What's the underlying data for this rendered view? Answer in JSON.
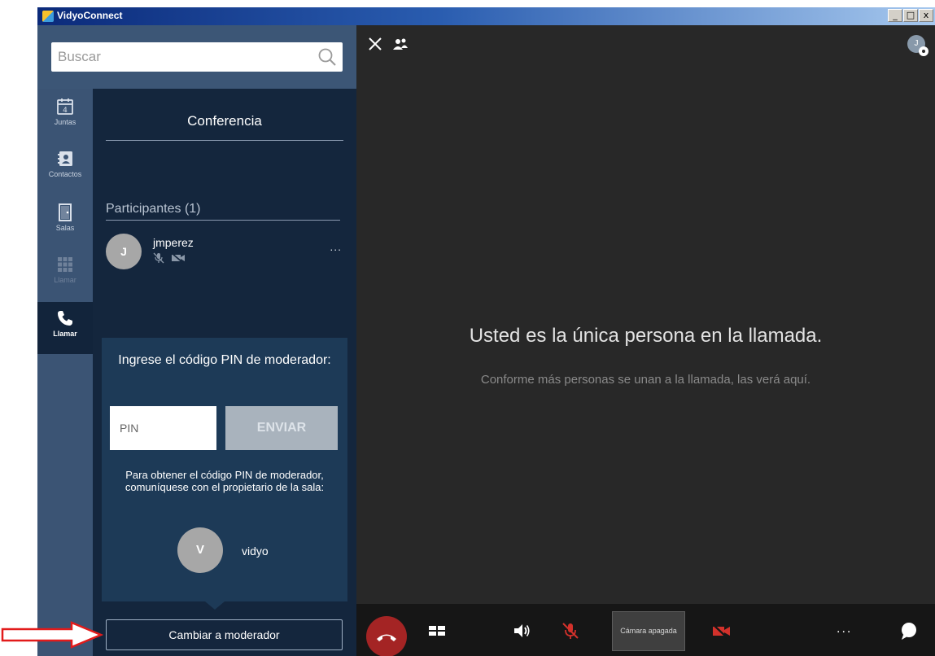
{
  "window": {
    "title": "VidyoConnect",
    "min_label": "_",
    "max_label": "□",
    "close_label": "x"
  },
  "search": {
    "placeholder": "Buscar",
    "value": ""
  },
  "nav": {
    "items": [
      {
        "label": "Juntas",
        "icon": "calendar-icon",
        "badge": "4"
      },
      {
        "label": "Contactos",
        "icon": "contacts-icon"
      },
      {
        "label": "Salas",
        "icon": "door-icon"
      },
      {
        "label": "Llamar",
        "icon": "dialpad-icon"
      },
      {
        "label": "Llamar",
        "icon": "phone-icon"
      }
    ]
  },
  "panel": {
    "conference_title": "Conferencia",
    "participants_title": "Participantes (1)",
    "participants": [
      {
        "initial": "J",
        "name": "jmperez",
        "more": "..."
      }
    ]
  },
  "pin_popup": {
    "title": "Ingrese el código PIN de moderador:",
    "pin_placeholder": "PIN",
    "send_label": "ENVIAR",
    "info": "Para obtener el código PIN de moderador, comuníquese con el propietario de la sala:",
    "owner_initial": "V",
    "owner_name": "vidyo"
  },
  "moderator_button": "Cambiar a moderador",
  "stage": {
    "title": "Usted es la única persona en la llamada.",
    "subtitle": "Conforme más personas se unan a la llamada, las verá aquí.",
    "user_initial": "J"
  },
  "toolbar": {
    "camera_status": "Cámara apagada",
    "more": "..."
  },
  "colors": {
    "accent_red": "#d2312b",
    "hangup": "#a42424",
    "panel": "#14263d",
    "annotation": "#e21b1b"
  }
}
